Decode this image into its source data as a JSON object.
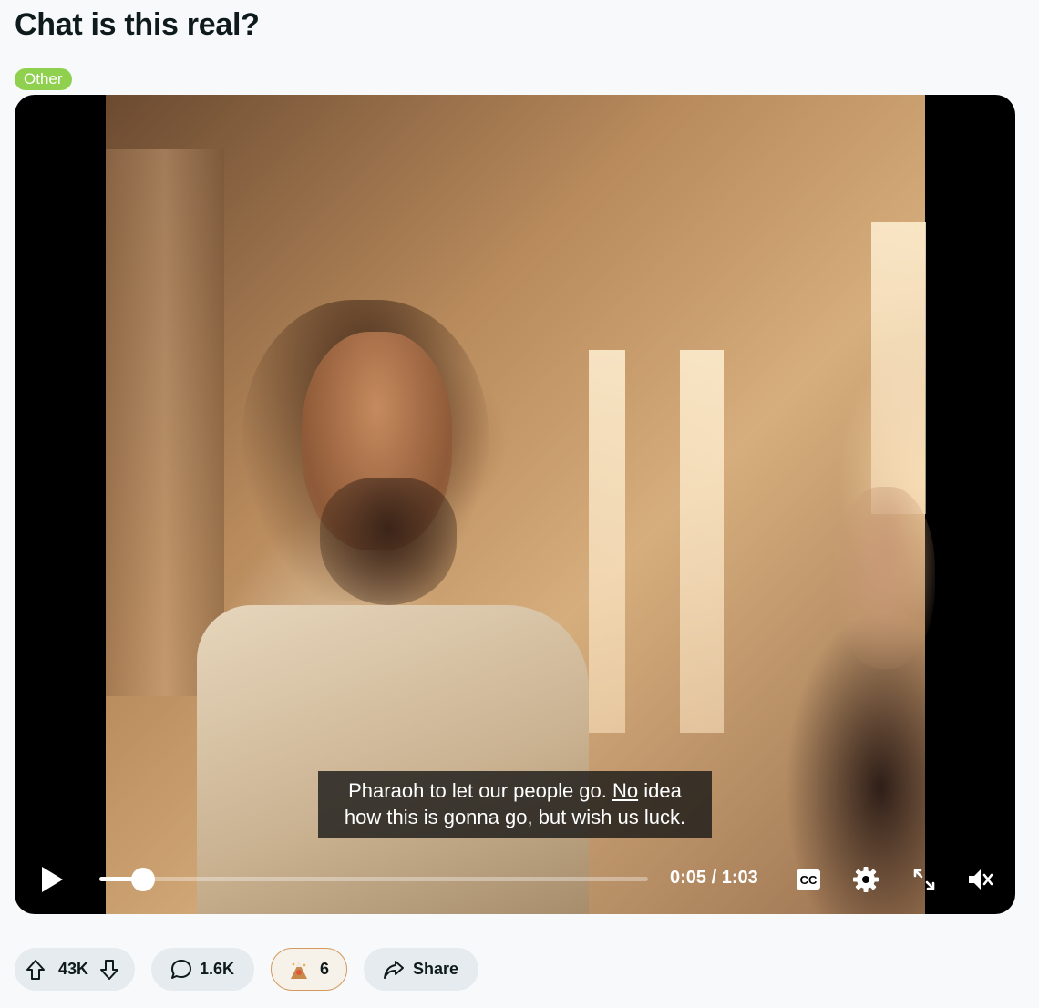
{
  "post": {
    "title": "Chat is this real?",
    "flair": "Other",
    "flair_color": "#8fd14f"
  },
  "video": {
    "subtitle_before": "Pharaoh to let our people go. ",
    "subtitle_underlined": "No",
    "subtitle_after": " idea how this is gonna go, but wish us luck.",
    "current_time": "0:05",
    "separator": " / ",
    "duration": "1:03",
    "progress_fraction": 0.08,
    "captions_label": "CC",
    "icons": {
      "play": "play-icon",
      "captions": "closed-captions-icon",
      "settings": "gear-icon",
      "fullscreen": "fullscreen-icon",
      "mute": "volume-muted-icon"
    }
  },
  "actions": {
    "votes": "43K",
    "comments": "1.6K",
    "awards": "6",
    "share": "Share",
    "icons": {
      "upvote": "upvote-arrow-icon",
      "downvote": "downvote-arrow-icon",
      "comment": "speech-bubble-icon",
      "award": "award-icon",
      "share": "share-arrow-icon"
    }
  }
}
